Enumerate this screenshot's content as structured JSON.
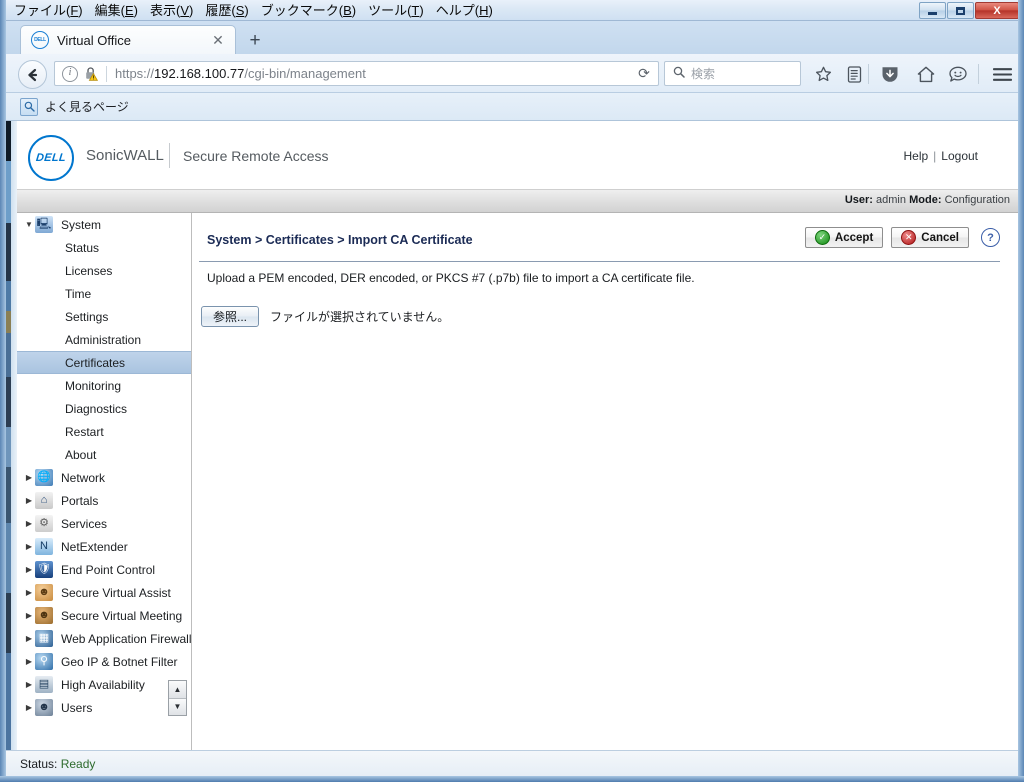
{
  "browser": {
    "menubar": [
      {
        "label": "ファイル",
        "accel": "F"
      },
      {
        "label": "編集",
        "accel": "E"
      },
      {
        "label": "表示",
        "accel": "V"
      },
      {
        "label": "履歴",
        "accel": "S"
      },
      {
        "label": "ブックマーク",
        "accel": "B"
      },
      {
        "label": "ツール",
        "accel": "T"
      },
      {
        "label": "ヘルプ",
        "accel": "H"
      }
    ],
    "window_controls": {
      "minimize": "minimize-icon",
      "maximize": "maximize-icon",
      "close": "X"
    },
    "tab": {
      "title": "Virtual Office",
      "favicon": "DELL",
      "close_label": "✕"
    },
    "new_tab_label": "+",
    "back_label": "←",
    "url": {
      "scheme": "https://",
      "host": "192.168.100.77",
      "path": "/cgi-bin/management",
      "full": "https://192.168.100.77/cgi-bin/management"
    },
    "reload_label": "⟳",
    "search": {
      "placeholder": "検索",
      "icon": "search-icon"
    },
    "toolbar_icons": [
      {
        "name": "bookmark-star-icon",
        "glyph": "☆"
      },
      {
        "name": "reader-list-icon",
        "glyph": "▤"
      },
      {
        "name": "downloads-icon",
        "glyph": "▼"
      },
      {
        "name": "home-icon",
        "glyph": "⌂"
      },
      {
        "name": "sync-smiley-icon",
        "glyph": "☺"
      },
      {
        "name": "hamburger-menu-icon",
        "glyph": "≡"
      }
    ],
    "bookmarks_bar": {
      "item_label": "よく見るページ",
      "item_icon": "most-visited-icon"
    },
    "statusbar": {
      "prefix": "Status:",
      "value": "Ready"
    }
  },
  "app": {
    "brand": {
      "logo_text": "DELL",
      "product": "SonicWALL",
      "tagline": "Secure Remote Access"
    },
    "header_links": {
      "help": "Help",
      "separator": "|",
      "logout": "Logout"
    },
    "status_strip": {
      "user_label": "User:",
      "user_value": "admin",
      "mode_label": "Mode:",
      "mode_value": "Configuration"
    }
  },
  "sidebar": {
    "groups": [
      {
        "label": "System",
        "icon": "monitor-icon",
        "expanded": true,
        "arrow": "▼",
        "children": [
          {
            "label": "Status",
            "selected": false
          },
          {
            "label": "Licenses",
            "selected": false
          },
          {
            "label": "Time",
            "selected": false
          },
          {
            "label": "Settings",
            "selected": false
          },
          {
            "label": "Administration",
            "selected": false
          },
          {
            "label": "Certificates",
            "selected": true
          },
          {
            "label": "Monitoring",
            "selected": false
          },
          {
            "label": "Diagnostics",
            "selected": false
          },
          {
            "label": "Restart",
            "selected": false
          },
          {
            "label": "About",
            "selected": false
          }
        ]
      },
      {
        "label": "Network",
        "icon": "globe-icon",
        "expanded": false,
        "arrow": "▶",
        "children": []
      },
      {
        "label": "Portals",
        "icon": "portal-house-icon",
        "expanded": false,
        "arrow": "▶",
        "children": []
      },
      {
        "label": "Services",
        "icon": "gears-icon",
        "expanded": false,
        "arrow": "▶",
        "children": []
      },
      {
        "label": "NetExtender",
        "icon": "netextender-icon",
        "expanded": false,
        "arrow": "▶",
        "children": []
      },
      {
        "label": "End Point Control",
        "icon": "shield-icon",
        "expanded": false,
        "arrow": "▶",
        "children": []
      },
      {
        "label": "Secure Virtual Assist",
        "icon": "headset-user-icon",
        "expanded": false,
        "arrow": "▶",
        "children": []
      },
      {
        "label": "Secure Virtual Meeting",
        "icon": "users-meeting-icon",
        "expanded": false,
        "arrow": "▶",
        "children": []
      },
      {
        "label": "Web Application Firewall",
        "icon": "globe-firewall-icon",
        "expanded": false,
        "arrow": "▶",
        "children": []
      },
      {
        "label": "Geo IP & Botnet Filter",
        "icon": "geoip-balloons-icon",
        "expanded": false,
        "arrow": "▶",
        "children": []
      },
      {
        "label": "High Availability",
        "icon": "server-stack-icon",
        "expanded": false,
        "arrow": "▶",
        "children": []
      },
      {
        "label": "Users",
        "icon": "users-icon",
        "expanded": false,
        "arrow": "▶",
        "children": []
      }
    ],
    "scroll": {
      "up": "▲",
      "down": "▼"
    }
  },
  "main": {
    "breadcrumb": "System > Certificates > Import CA Certificate",
    "actions": {
      "accept": "Accept",
      "cancel": "Cancel",
      "help_glyph": "?"
    },
    "description": "Upload a PEM encoded, DER encoded, or PKCS #7 (.p7b) file to import a CA certificate file.",
    "file_upload": {
      "button_label": "参照...",
      "no_file_text": "ファイルが選択されていません。"
    }
  },
  "colors": {
    "dell_blue": "#0076ce",
    "breadcrumb_navy": "#1b2b55",
    "selected_row": "#aac4e0",
    "status_ready_green": "#2d6b2d"
  }
}
